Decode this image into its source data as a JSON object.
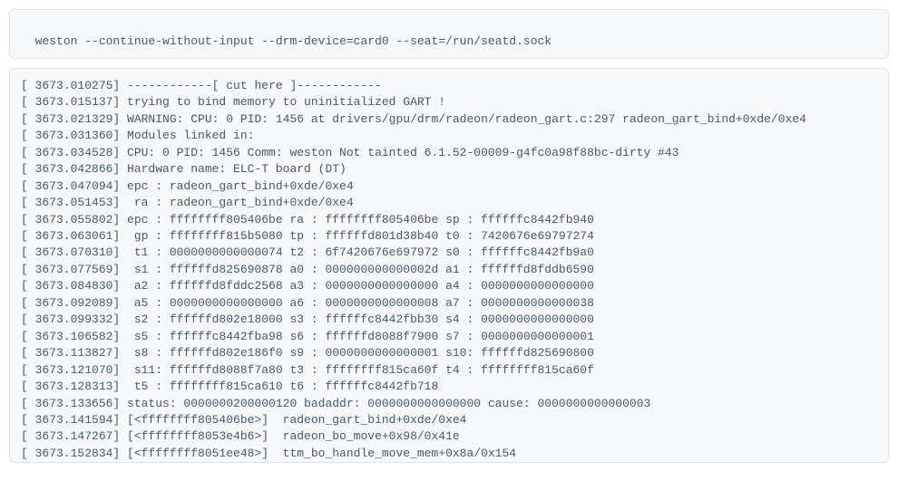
{
  "command": "weston --continue-without-input --drm-device=card0 --seat=/run/seatd.sock",
  "log_lines": [
    "[ 3673.010275] ------------[ cut here ]------------",
    "[ 3673.015137] trying to bind memory to uninitialized GART !",
    "[ 3673.021329] WARNING: CPU: 0 PID: 1456 at drivers/gpu/drm/radeon/radeon_gart.c:297 radeon_gart_bind+0xde/0xe4",
    "[ 3673.031360] Modules linked in:",
    "[ 3673.034528] CPU: 0 PID: 1456 Comm: weston Not tainted 6.1.52-00009-g4fc0a98f88bc-dirty #43",
    "[ 3673.042866] Hardware name: ELC-T board (DT)",
    "[ 3673.047094] epc : radeon_gart_bind+0xde/0xe4",
    "[ 3673.051453]  ra : radeon_gart_bind+0xde/0xe4",
    "[ 3673.055802] epc : ffffffff805406be ra : ffffffff805406be sp : ffffffc8442fb940",
    "[ 3673.063061]  gp : ffffffff815b5080 tp : ffffffd801d38b40 t0 : 7420676e69797274",
    "[ 3673.070310]  t1 : 0000000000000074 t2 : 6f7420676e697972 s0 : ffffffc8442fb9a0",
    "[ 3673.077569]  s1 : ffffffd825690878 a0 : 000000000000002d a1 : ffffffd8fddb6590",
    "[ 3673.084830]  a2 : ffffffd8fddc2568 a3 : 0000000000000000 a4 : 0000000000000000",
    "[ 3673.092089]  a5 : 0000000000000000 a6 : 0000000000000008 a7 : 0000000000000038",
    "[ 3673.099332]  s2 : ffffffd802e18000 s3 : ffffffc8442fbb30 s4 : 0000000000000000",
    "[ 3673.106582]  s5 : ffffffc8442fba98 s6 : ffffffd8088f7900 s7 : 0000000000000001",
    "[ 3673.113827]  s8 : ffffffd802e186f0 s9 : 0000000000000001 s10: ffffffd825690800",
    "[ 3673.121070]  s11: ffffffd8088f7a80 t3 : ffffffff815ca60f t4 : ffffffff815ca60f",
    "[ 3673.128313]  t5 : ffffffff815ca610 t6 : ffffffc8442fb718",
    "[ 3673.133656] status: 0000000200000120 badaddr: 0000000000000000 cause: 0000000000000003",
    "[ 3673.141594] [<ffffffff805406be>]  radeon_gart_bind+0xde/0xe4",
    "[ 3673.147267] [<ffffffff8053e4b6>]  radeon_bo_move+0x98/0x41e",
    "[ 3673.152834] [<ffffffff8051ee48>]  ttm_bo_handle_move_mem+0x8a/0x154"
  ]
}
